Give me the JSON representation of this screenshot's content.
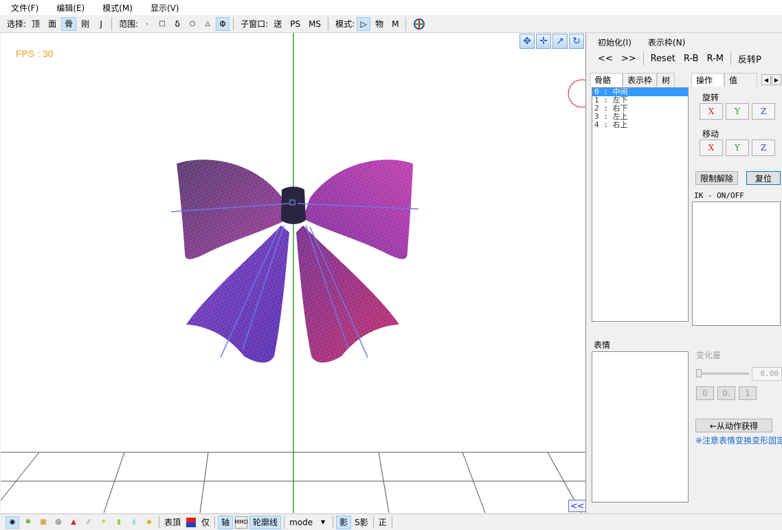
{
  "menu": [
    "文件(F)",
    "编辑(E)",
    "模式(M)",
    "显示(V)"
  ],
  "toolbar": {
    "select_label": "选择:",
    "select_items": [
      "顶",
      "面",
      "骨",
      "刚",
      "J"
    ],
    "range_label": "范围:",
    "range_items": [
      "·",
      "□",
      "δ",
      "○",
      "△",
      "Φ"
    ],
    "subwin_label": "子窗口:",
    "subwin_items": [
      "送",
      "PS",
      "MS"
    ],
    "mode_label": "模式:",
    "mode_items": [
      "▷",
      "物",
      "M"
    ]
  },
  "viewport": {
    "fps": "FPS : 30",
    "collapse": "<<"
  },
  "panel": {
    "menu": [
      "初始化(I)",
      "表示枠(N)"
    ],
    "tools": [
      "<<",
      ">>",
      "Reset",
      "R-B",
      "R-M",
      "反转P"
    ],
    "left_tabs": [
      "骨骼",
      "表示枠",
      "树"
    ],
    "right_tabs": [
      "操作",
      "值"
    ],
    "bones": [
      "0 : 中间",
      "1 : 左下",
      "2 : 右下",
      "3 : 左上",
      "4 : 右上"
    ],
    "rotate_label": "旋转",
    "move_label": "移动",
    "axes": [
      "X",
      "Y",
      "Z"
    ],
    "limit_button": "限制解除",
    "reset_button": "复位",
    "ik_label": "IK - ON/OFF",
    "expression_label": "表情",
    "change_label": "变化量",
    "change_value": "0.00",
    "small_buttons": [
      "0",
      "0.",
      "1"
    ],
    "from_motion_button": "←从动作获得",
    "note": "※注意表情变换变形固定"
  },
  "statusbar": {
    "face_top": "表頂",
    "only": "仅",
    "axis": "轴",
    "outline": "轮廓线",
    "mode": "mode",
    "shadow": "影",
    "s_shadow": "S影",
    "front": "正"
  },
  "colors": {
    "x_axis": "#e02020",
    "y_axis": "#20a020",
    "z_axis": "#2040e0",
    "fps": "#f0a020",
    "bow_dark": "#5a3a80",
    "bow_light": "#c040a0"
  }
}
